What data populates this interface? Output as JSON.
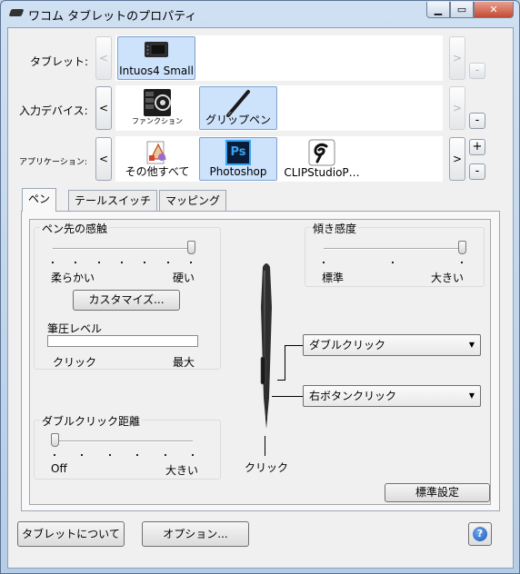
{
  "window": {
    "title": "ワコム タブレットのプロパティ"
  },
  "rows": {
    "tablet_label": "タブレット:",
    "device_label": "入力デバイス:",
    "app_label": "アプリケーション:"
  },
  "tablet": {
    "items": [
      "Intuos4 Small"
    ]
  },
  "devices": {
    "items": [
      "ファンクション",
      "グリップペン"
    ]
  },
  "apps": {
    "items": [
      "その他すべて",
      "Photoshop",
      "CLIPStudioP…"
    ],
    "photoshop_icon_text": "Ps"
  },
  "nav": {
    "prev": "<",
    "next": ">",
    "add": "+",
    "remove": "-"
  },
  "tabs": [
    "ペン",
    "テールスイッチ",
    "マッピング"
  ],
  "pen_tip": {
    "title": "ペン先の感触",
    "soft": "柔らかい",
    "firm": "硬い",
    "customize": "カスタマイズ...",
    "pressure_label": "筆圧レベル",
    "click": "クリック",
    "max": "最大",
    "feel_level": 6,
    "feel_max": 6,
    "pressure_fraction": 0
  },
  "double_click": {
    "title": "ダブルクリック距離",
    "off": "Off",
    "large": "大きい",
    "level": 0,
    "max": 5
  },
  "tilt": {
    "title": "傾き感度",
    "normal": "標準",
    "large": "大きい",
    "level": 2,
    "max": 2
  },
  "pen_buttons": {
    "upper": "ダブルクリック",
    "lower": "右ボタンクリック",
    "tip": "クリック"
  },
  "default_button": "標準設定",
  "footer": {
    "about": "タブレットについて",
    "options": "オプション...",
    "help": "?"
  }
}
